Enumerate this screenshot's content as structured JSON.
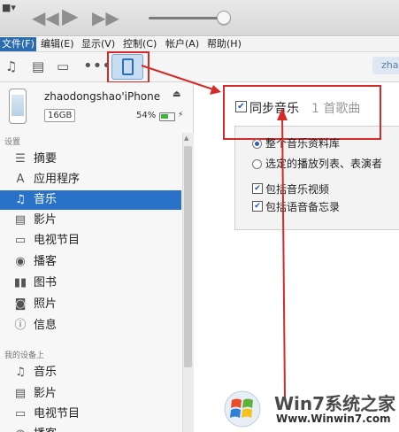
{
  "colors": {
    "accent": "#2a72c8",
    "annotation_red": "#d42a2a",
    "battery": "#3fb23f"
  },
  "menubar": {
    "items": [
      "文件(F)",
      "编辑(E)",
      "显示(V)",
      "控制(C)",
      "帐户(A)",
      "帮助(H)"
    ]
  },
  "toolbar": {
    "icons": [
      "music-note-icon",
      "film-icon",
      "tv-icon",
      "more-icon",
      "iphone-icon"
    ],
    "user_tab": "zha"
  },
  "device": {
    "name": "zhaodongshao'iPhone",
    "capacity": "16GB",
    "battery_percent_label": "54%",
    "battery_level": 0.54
  },
  "sidebar": {
    "settings_label": "设置",
    "settings_items": [
      {
        "label": "摘要",
        "icon": "summary-icon"
      },
      {
        "label": "应用程序",
        "icon": "apps-icon"
      },
      {
        "label": "音乐",
        "icon": "music-note-icon",
        "selected": true
      },
      {
        "label": "影片",
        "icon": "film-icon"
      },
      {
        "label": "电视节目",
        "icon": "tv-icon"
      },
      {
        "label": "播客",
        "icon": "podcast-icon"
      },
      {
        "label": "图书",
        "icon": "book-icon"
      },
      {
        "label": "照片",
        "icon": "camera-icon"
      },
      {
        "label": "信息",
        "icon": "info-icon"
      }
    ],
    "ondevice_label": "我的设备上",
    "ondevice_items": [
      {
        "label": "音乐",
        "icon": "music-note-icon"
      },
      {
        "label": "影片",
        "icon": "film-icon"
      },
      {
        "label": "电视节目",
        "icon": "tv-icon"
      },
      {
        "label": "播客",
        "icon": "podcast-icon"
      }
    ]
  },
  "main": {
    "sync_label": "同步音乐",
    "sync_checked": true,
    "sync_count": "1 首歌曲",
    "option_entire_library": "整个音乐资料库",
    "option_selected": "选定的播放列表、表演者",
    "include_videos": "包括音乐视频",
    "include_voice_memos": "包括语音备忘录"
  },
  "watermark": {
    "title": "Win7系统之家",
    "url": "Www.Winwin7.com"
  }
}
